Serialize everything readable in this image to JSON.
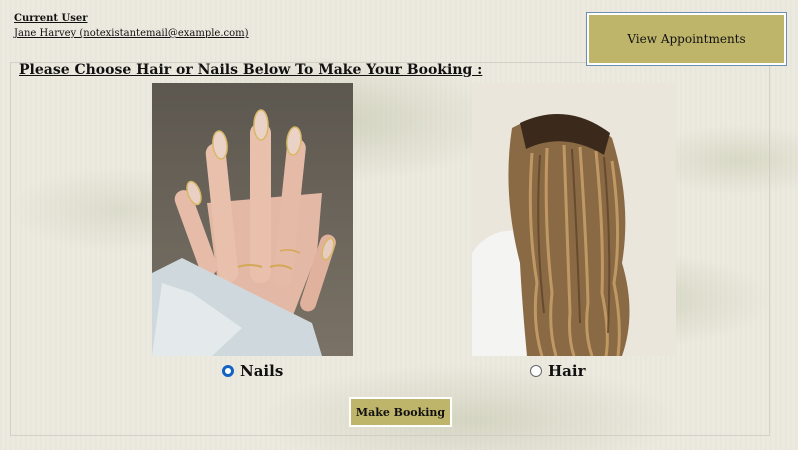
{
  "user": {
    "label": "Current User",
    "name_email": "Jane Harvey (notexistantemail@example.com)"
  },
  "header": {
    "view_appointments_label": "View Appointments"
  },
  "main": {
    "heading": "Please Choose Hair or Nails Below To Make Your Booking :",
    "options": [
      {
        "label": "Nails",
        "selected": true
      },
      {
        "label": "Hair",
        "selected": false
      }
    ],
    "make_booking_label": "Make Booking"
  },
  "colors": {
    "button_bg": "#bfb56a",
    "radio_selected": "#1463c4"
  }
}
